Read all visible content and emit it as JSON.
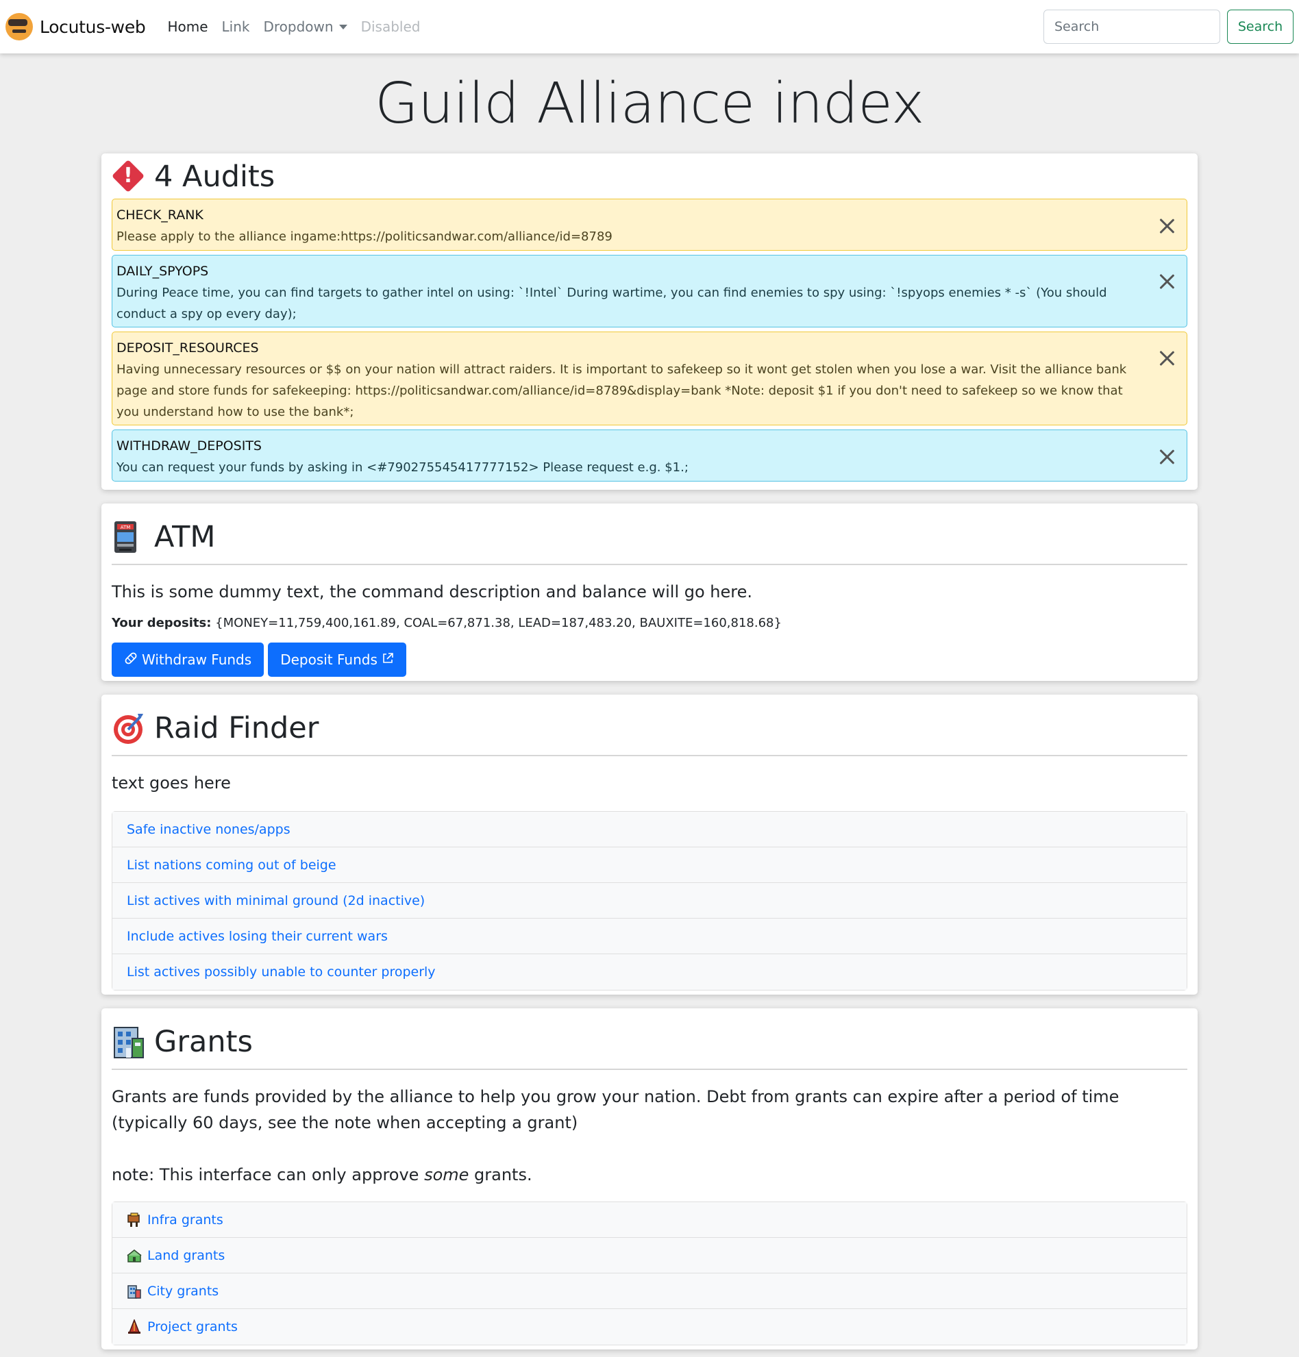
{
  "navbar": {
    "brand": "Locutus-web",
    "links": [
      "Home",
      "Link",
      "Dropdown",
      "Disabled"
    ],
    "search_placeholder": "Search",
    "search_button": "Search"
  },
  "page": {
    "title": "Guild Alliance index"
  },
  "audits": {
    "heading": "4 Audits",
    "items": [
      {
        "title": "CHECK_RANK",
        "text": "Please apply to the alliance ingame:https://politicsandwar.com/alliance/id=8789",
        "variant": "warning"
      },
      {
        "title": "DAILY_SPYOPS",
        "text": "During Peace time, you can find targets to gather intel on using: `!Intel` During wartime, you can find enemies to spy using: `!spyops enemies * -s` (You should conduct a spy op every day);",
        "variant": "info"
      },
      {
        "title": "DEPOSIT_RESOURCES",
        "text": "Having unnecessary resources or $$ on your nation will attract raiders. It is important to safekeep so it wont get stolen when you lose a war. Visit the alliance bank page and store funds for safekeeping: https://politicsandwar.com/alliance/id=8789&display=bank *Note: deposit $1 if you don't need to safekeep so we know that you understand how to use the bank*;",
        "variant": "warning"
      },
      {
        "title": "WITHDRAW_DEPOSITS",
        "text": "You can request your funds by asking in <#790275545417777152> Please request e.g. $1.;",
        "variant": "info"
      }
    ]
  },
  "atm": {
    "heading": "ATM",
    "description": "This is some dummy text, the command description and balance will go here.",
    "deposits_label": "Your deposits:",
    "deposits_value": " {MONEY=11,759,400,161.89, COAL=67,871.38, LEAD=187,483.20, BAUXITE=160,818.68}",
    "withdraw_button": "Withdraw Funds",
    "deposit_button": "Deposit Funds"
  },
  "raid": {
    "heading": "Raid Finder",
    "description": "text goes here",
    "links": [
      "Safe inactive nones/apps",
      "List nations coming out of beige",
      "List actives with minimal ground (2d inactive)",
      "Include actives losing their current wars",
      "List actives possibly unable to counter properly"
    ]
  },
  "grants": {
    "heading": "Grants",
    "description": "Grants are funds provided by the alliance to help you grow your nation. Debt from grants can expire after a period of time (typically 60 days, see the note when accepting a grant)",
    "note_prefix": "note: This interface can only approve ",
    "note_emphasis": "some",
    "note_suffix": " grants.",
    "links": [
      {
        "label": "Infra grants",
        "icon": "infra-icon"
      },
      {
        "label": "Land grants",
        "icon": "land-icon"
      },
      {
        "label": "City grants",
        "icon": "city-icon"
      },
      {
        "label": "Project grants",
        "icon": "project-icon"
      }
    ]
  },
  "colors": {
    "primary": "#0d6efd",
    "success": "#198754",
    "danger": "#dc3545",
    "warning_bg": "#fff3cd",
    "info_bg": "#cff4fc",
    "page_bg": "#eeeeee"
  }
}
